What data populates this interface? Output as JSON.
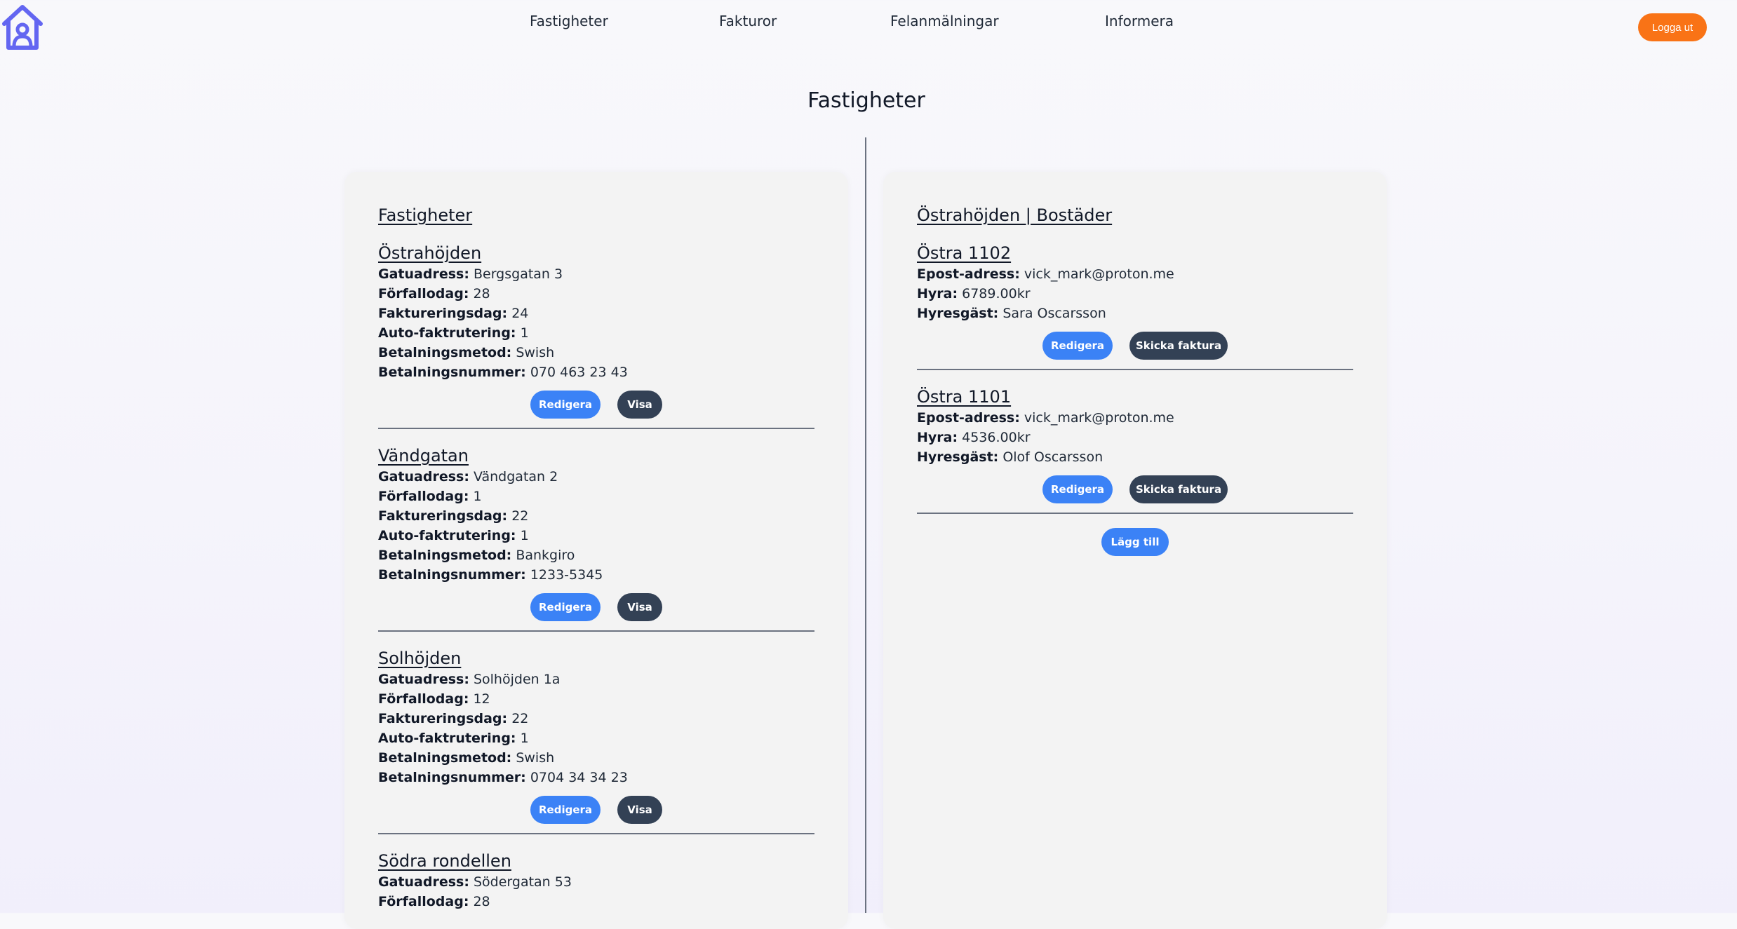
{
  "header": {
    "logo_icon": "house-user-icon",
    "nav": [
      {
        "label": "Fastigheter"
      },
      {
        "label": "Fakturor"
      },
      {
        "label": "Felanmälningar"
      },
      {
        "label": "Informera"
      }
    ],
    "logout_label": "Logga ut"
  },
  "page_title": "Fastigheter",
  "colors": {
    "accent_blue": "#3b82f6",
    "dark_button": "#334155",
    "logout_orange": "#f97316",
    "logo_purple": "#6366f1"
  },
  "properties_panel": {
    "heading": "Fastigheter",
    "labels": {
      "address": "Gatuadress:",
      "due_day": "Förfallodag:",
      "invoice_day": "Faktureringsdag:",
      "auto_invoice": "Auto-faktrutering:",
      "payment_method": "Betalningsmetod:",
      "payment_number": "Betalningsnummer:"
    },
    "edit_label": "Redigera",
    "show_label": "Visa",
    "items": [
      {
        "name": "Östrahöjden",
        "address": "Bergsgatan 3",
        "due_day": "28",
        "invoice_day": "24",
        "auto_invoice": "1",
        "payment_method": "Swish",
        "payment_number": "070 463 23 43"
      },
      {
        "name": "Vändgatan",
        "address": "Vändgatan 2",
        "due_day": "1",
        "invoice_day": "22",
        "auto_invoice": "1",
        "payment_method": "Bankgiro",
        "payment_number": "1233-5345"
      },
      {
        "name": "Solhöjden",
        "address": "Solhöjden 1a",
        "due_day": "12",
        "invoice_day": "22",
        "auto_invoice": "1",
        "payment_method": "Swish",
        "payment_number": "0704 34 34 23"
      },
      {
        "name": "Södra rondellen",
        "address": "Södergatan 53",
        "due_day": "28"
      }
    ]
  },
  "residences_panel": {
    "heading": "Östrahöjden | Bostäder",
    "labels": {
      "email": "Epost-adress:",
      "rent": "Hyra:",
      "tenant": "Hyresgäst:"
    },
    "edit_label": "Redigera",
    "invoice_label": "Skicka faktura",
    "add_label": "Lägg till",
    "items": [
      {
        "name": "Östra 1102",
        "email": "vick_mark@proton.me",
        "rent": "6789.00kr",
        "tenant": "Sara Oscarsson"
      },
      {
        "name": "Östra 1101",
        "email": "vick_mark@proton.me",
        "rent": "4536.00kr",
        "tenant": "Olof Oscarsson"
      }
    ]
  }
}
